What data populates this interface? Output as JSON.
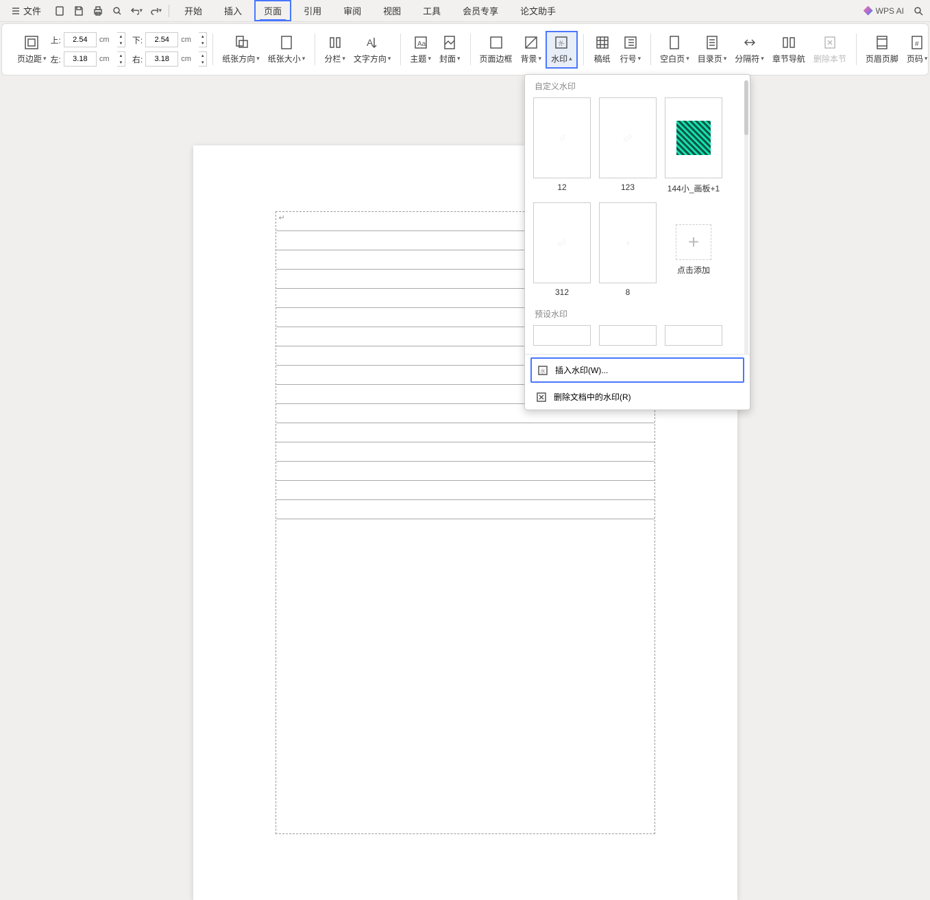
{
  "menu": {
    "file": "文件",
    "tabs": [
      "开始",
      "插入",
      "页面",
      "引用",
      "审阅",
      "视图",
      "工具",
      "会员专享",
      "论文助手"
    ],
    "active_tab_index": 2,
    "wps_ai": "WPS AI"
  },
  "ribbon": {
    "margins_label": "页边距",
    "margin_top": {
      "label": "上:",
      "value": "2.54",
      "unit": "cm"
    },
    "margin_bottom": {
      "label": "下:",
      "value": "2.54",
      "unit": "cm"
    },
    "margin_left": {
      "label": "左:",
      "value": "3.18",
      "unit": "cm"
    },
    "margin_right": {
      "label": "右:",
      "value": "3.18",
      "unit": "cm"
    },
    "orientation": "纸张方向",
    "paper_size": "纸张大小",
    "columns": "分栏",
    "text_direction": "文字方向",
    "theme": "主题",
    "cover": "封面",
    "page_border": "页面边框",
    "background": "背景",
    "watermark": "水印",
    "manuscript": "稿纸",
    "line_numbers": "行号",
    "blank_page": "空白页",
    "toc_page": "目录页",
    "separator": "分隔符",
    "chapter_nav": "章节导航",
    "delete_section": "删除本节",
    "header_footer": "页眉页脚",
    "page_number": "页码"
  },
  "watermark_panel": {
    "custom_title": "自定义水印",
    "preset_title": "预设水印",
    "items": [
      {
        "label": "12"
      },
      {
        "label": "123"
      },
      {
        "label": "144小_画板+1"
      },
      {
        "label": "312"
      },
      {
        "label": "8"
      }
    ],
    "add_label": "点击添加",
    "insert_watermark": "插入水印(W)...",
    "delete_watermark": "删除文档中的水印(R)"
  }
}
